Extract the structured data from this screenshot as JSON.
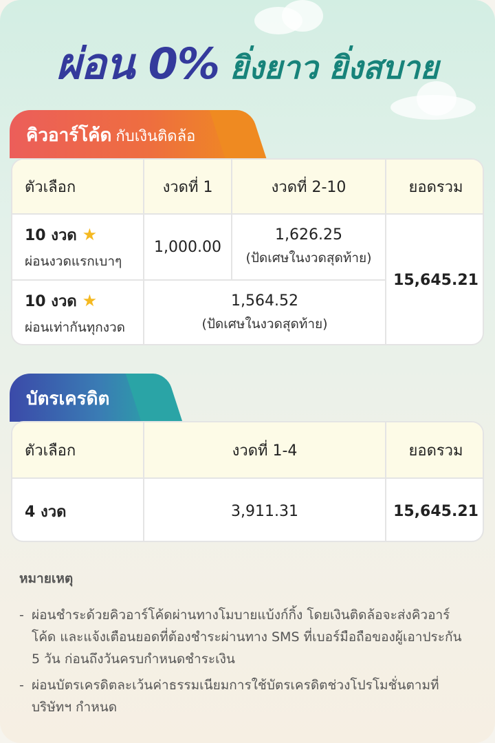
{
  "headline": {
    "main": "ผ่อน 0%",
    "sub": "ยิ่งยาว ยิ่งสบาย"
  },
  "qr_section": {
    "tab_title": "คิวอาร์โค้ด",
    "tab_subtitle": "กับเงินติดล้อ",
    "headers": [
      "ตัวเลือก",
      "งวดที่ 1",
      "งวดที่ 2-10",
      "ยอดรวม"
    ],
    "rows": [
      {
        "option": "10 งวด",
        "option_note": "ผ่อนงวดแรกเบาๆ",
        "first_installment": "1,000.00",
        "later_installments": "1,626.25",
        "later_note": "(ปัดเศษในงวดสุดท้าย)"
      },
      {
        "option": "10 งวด",
        "option_note": "ผ่อนเท่ากันทุกงวด",
        "installment": "1,564.52",
        "installment_note": "(ปัดเศษในงวดสุดท้าย)"
      }
    ],
    "total": "15,645.21"
  },
  "cc_section": {
    "tab_title": "บัตรเครดิต",
    "headers": [
      "ตัวเลือก",
      "งวดที่ 1-4",
      "ยอดรวม"
    ],
    "row": {
      "option": "4 งวด",
      "installment": "3,911.31",
      "total": "15,645.21"
    }
  },
  "notes": {
    "title": "หมายเหตุ",
    "items": [
      "ผ่อนชำระด้วยคิวอาร์โค้ดผ่านทางโมบายแบ้งก์กิ้ง โดยเงินติดล้อจะส่งคิวอาร์โค้ด และแจ้งเตือนยอดที่ต้องชำระผ่านทาง SMS ที่เบอร์มือถือของผู้เอาประกัน 5 วัน ก่อนถึงวันครบกำหนดชำระเงิน",
      "ผ่อนบัตรเครดิตละเว้นค่าธรรมเนียมการใช้บัตรเครดิตช่วงโปรโมชั่นตามที่บริษัทฯ กำหนด"
    ]
  },
  "colors": {
    "headline_main": "#343a9c",
    "headline_sub": "#17837a",
    "qr_tab": "#ee6e3f",
    "cc_tab": "#3a7cb4",
    "header_bg": "#fdfbe7",
    "star": "#f5b921"
  },
  "icons": {
    "star": "star-icon"
  }
}
